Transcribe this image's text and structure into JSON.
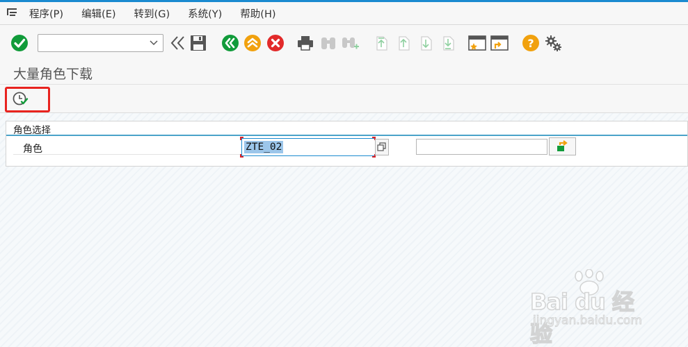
{
  "menu": {
    "items": [
      "程序(P)",
      "编辑(E)",
      "转到(G)",
      "系统(Y)",
      "帮助(H)"
    ]
  },
  "toolbar": {
    "command_value": "",
    "icons": [
      "enter-icon",
      "command-dropdown-icon",
      "back-double-icon",
      "save-icon",
      "back-icon",
      "exit-icon",
      "cancel-icon",
      "print-icon",
      "find-icon",
      "find-next-icon",
      "first-page-icon",
      "previous-page-icon",
      "next-page-icon",
      "last-page-icon",
      "create-session-icon",
      "shortcut-icon",
      "help-icon",
      "customize-layout-icon"
    ]
  },
  "title": "大量角色下载",
  "app_toolbar": {
    "execute_icon": "execute-clock-icon"
  },
  "selection": {
    "group_title": "角色选择",
    "field_label": "角色",
    "low_value": "ZTE_02",
    "high_value": ""
  },
  "watermark": {
    "brand": "Bai du 经验",
    "url": "jingyan.baidu.com"
  },
  "colors": {
    "accent": "#1a8ad0",
    "green": "#119b3a",
    "orange": "#f1a10e",
    "red": "#e22a2a",
    "highlight": "#e8231f",
    "selection": "#9cc6ea"
  }
}
